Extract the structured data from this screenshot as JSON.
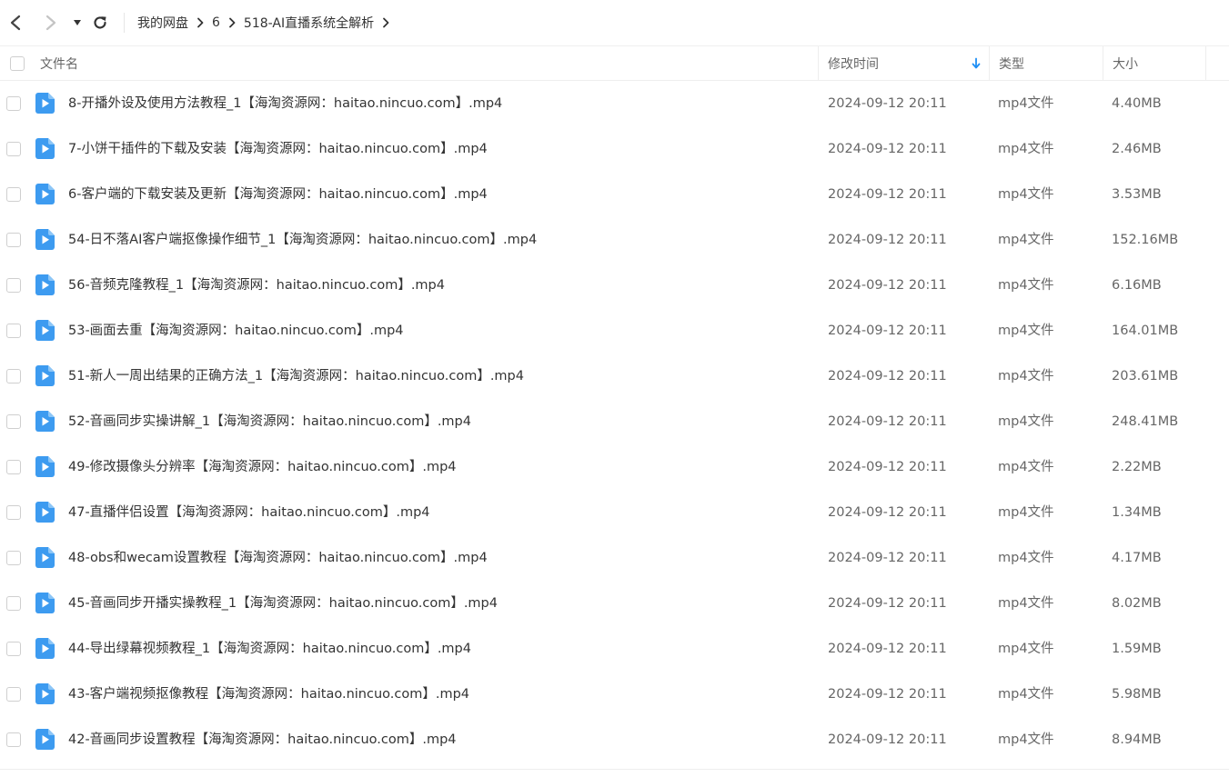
{
  "breadcrumb": [
    {
      "label": "我的网盘"
    },
    {
      "label": "6"
    },
    {
      "label": "518-AI直播系统全解析"
    }
  ],
  "columns": {
    "name": "文件名",
    "modified": "修改时间",
    "type": "类型",
    "size": "大小"
  },
  "sort": {
    "column": "modified",
    "direction": "desc"
  },
  "colors": {
    "accent": "#1e8ef5",
    "file_icon": "#3d9bf0"
  },
  "files": [
    {
      "name": "8-开播外设及使用方法教程_1【海淘资源网：haitao.nincuo.com】.mp4",
      "modified": "2024-09-12 20:11",
      "type": "mp4文件",
      "size": "4.40MB",
      "icon": "video-file-icon"
    },
    {
      "name": "7-小饼干插件的下载及安装【海淘资源网：haitao.nincuo.com】.mp4",
      "modified": "2024-09-12 20:11",
      "type": "mp4文件",
      "size": "2.46MB",
      "icon": "video-file-icon"
    },
    {
      "name": "6-客户端的下载安装及更新【海淘资源网：haitao.nincuo.com】.mp4",
      "modified": "2024-09-12 20:11",
      "type": "mp4文件",
      "size": "3.53MB",
      "icon": "video-file-icon"
    },
    {
      "name": "54-日不落AI客户端抠像操作细节_1【海淘资源网：haitao.nincuo.com】.mp4",
      "modified": "2024-09-12 20:11",
      "type": "mp4文件",
      "size": "152.16MB",
      "icon": "video-file-icon"
    },
    {
      "name": "56-音频克隆教程_1【海淘资源网：haitao.nincuo.com】.mp4",
      "modified": "2024-09-12 20:11",
      "type": "mp4文件",
      "size": "6.16MB",
      "icon": "video-file-icon"
    },
    {
      "name": "53-画面去重【海淘资源网：haitao.nincuo.com】.mp4",
      "modified": "2024-09-12 20:11",
      "type": "mp4文件",
      "size": "164.01MB",
      "icon": "video-file-icon"
    },
    {
      "name": "51-新人一周出结果的正确方法_1【海淘资源网：haitao.nincuo.com】.mp4",
      "modified": "2024-09-12 20:11",
      "type": "mp4文件",
      "size": "203.61MB",
      "icon": "video-file-icon"
    },
    {
      "name": "52-音画同步实操讲解_1【海淘资源网：haitao.nincuo.com】.mp4",
      "modified": "2024-09-12 20:11",
      "type": "mp4文件",
      "size": "248.41MB",
      "icon": "video-file-icon"
    },
    {
      "name": "49-修改摄像头分辨率【海淘资源网：haitao.nincuo.com】.mp4",
      "modified": "2024-09-12 20:11",
      "type": "mp4文件",
      "size": "2.22MB",
      "icon": "video-file-icon"
    },
    {
      "name": "47-直播伴侣设置【海淘资源网：haitao.nincuo.com】.mp4",
      "modified": "2024-09-12 20:11",
      "type": "mp4文件",
      "size": "1.34MB",
      "icon": "video-file-icon"
    },
    {
      "name": "48-obs和wecam设置教程【海淘资源网：haitao.nincuo.com】.mp4",
      "modified": "2024-09-12 20:11",
      "type": "mp4文件",
      "size": "4.17MB",
      "icon": "video-file-icon"
    },
    {
      "name": "45-音画同步开播实操教程_1【海淘资源网：haitao.nincuo.com】.mp4",
      "modified": "2024-09-12 20:11",
      "type": "mp4文件",
      "size": "8.02MB",
      "icon": "video-file-icon"
    },
    {
      "name": "44-导出绿幕视频教程_1【海淘资源网：haitao.nincuo.com】.mp4",
      "modified": "2024-09-12 20:11",
      "type": "mp4文件",
      "size": "1.59MB",
      "icon": "video-file-icon"
    },
    {
      "name": "43-客户端视频抠像教程【海淘资源网：haitao.nincuo.com】.mp4",
      "modified": "2024-09-12 20:11",
      "type": "mp4文件",
      "size": "5.98MB",
      "icon": "video-file-icon"
    },
    {
      "name": "42-音画同步设置教程【海淘资源网：haitao.nincuo.com】.mp4",
      "modified": "2024-09-12 20:11",
      "type": "mp4文件",
      "size": "8.94MB",
      "icon": "video-file-icon"
    }
  ]
}
